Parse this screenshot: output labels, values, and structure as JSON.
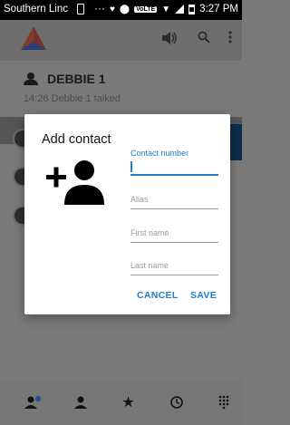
{
  "status_bar": {
    "carrier": "Southern Linc",
    "time": "3:27 PM",
    "dots": "···",
    "lte": "VoLTE"
  },
  "app_bar": {
    "logo": "app-logo",
    "actions": [
      "speaker-icon",
      "search-icon",
      "more-vert-icon"
    ]
  },
  "conversation": {
    "contact_name": "DEBBIE 1",
    "last_message": "14:26 Debbie 1 talked"
  },
  "dialog": {
    "title": "Add contact",
    "fields": {
      "contact_number": {
        "label": "Contact number",
        "value": ""
      },
      "alias": {
        "placeholder": "Alias"
      },
      "first_name": {
        "placeholder": "First name"
      },
      "last_name": {
        "placeholder": "Last name"
      }
    },
    "cancel_label": "CANCEL",
    "save_label": "SAVE"
  },
  "bottom_nav": [
    "group-add-icon",
    "person-icon",
    "star-icon",
    "clock-icon",
    "dialpad-icon"
  ],
  "colors": {
    "accent": "#1e7ec8",
    "overlay_bg": "#7a7a7a",
    "dialog_bg": "#ffffff"
  }
}
